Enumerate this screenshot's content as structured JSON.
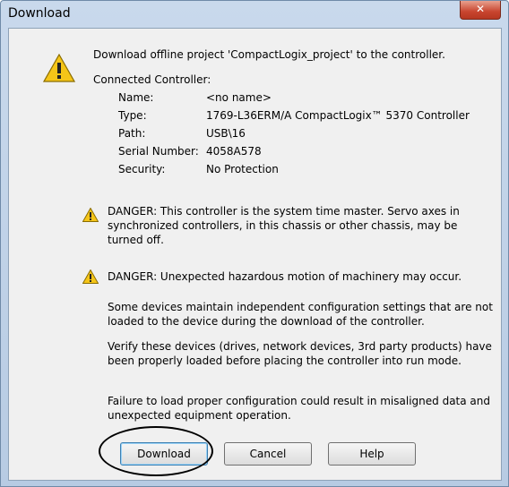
{
  "window": {
    "title": "Download",
    "close_glyph": "✕"
  },
  "message": "Download offline project 'CompactLogix_project' to the controller.",
  "controller": {
    "heading": "Connected Controller:",
    "rows": [
      {
        "label": "Name:",
        "value": "<no name>"
      },
      {
        "label": "Type:",
        "value": "1769-L36ERM/A CompactLogix™ 5370 Controller"
      },
      {
        "label": "Path:",
        "value": "USB\\16"
      },
      {
        "label": "Serial Number:",
        "value": "4058A578"
      },
      {
        "label": "Security:",
        "value": "No Protection"
      }
    ]
  },
  "warnings": {
    "danger1": "DANGER: This controller is the system time master.  Servo axes in synchronized controllers, in this chassis or other chassis, may be turned off.",
    "danger2": "DANGER: Unexpected hazardous motion of machinery may occur.",
    "para1": "Some devices maintain independent configuration settings that are not loaded to the device during the download of the controller.",
    "para2": "Verify these devices (drives, network devices, 3rd party products) have been properly loaded before placing the controller into run mode.",
    "para3": "Failure to load proper configuration could result in misaligned data and unexpected equipment operation."
  },
  "buttons": {
    "download": "Download",
    "cancel": "Cancel",
    "help": "Help"
  },
  "icons": {
    "main_warning": "warning-icon",
    "small_warning": "warning-icon"
  },
  "colors": {
    "warning_yellow": "#f5c518",
    "close_red": "#c8452f"
  }
}
